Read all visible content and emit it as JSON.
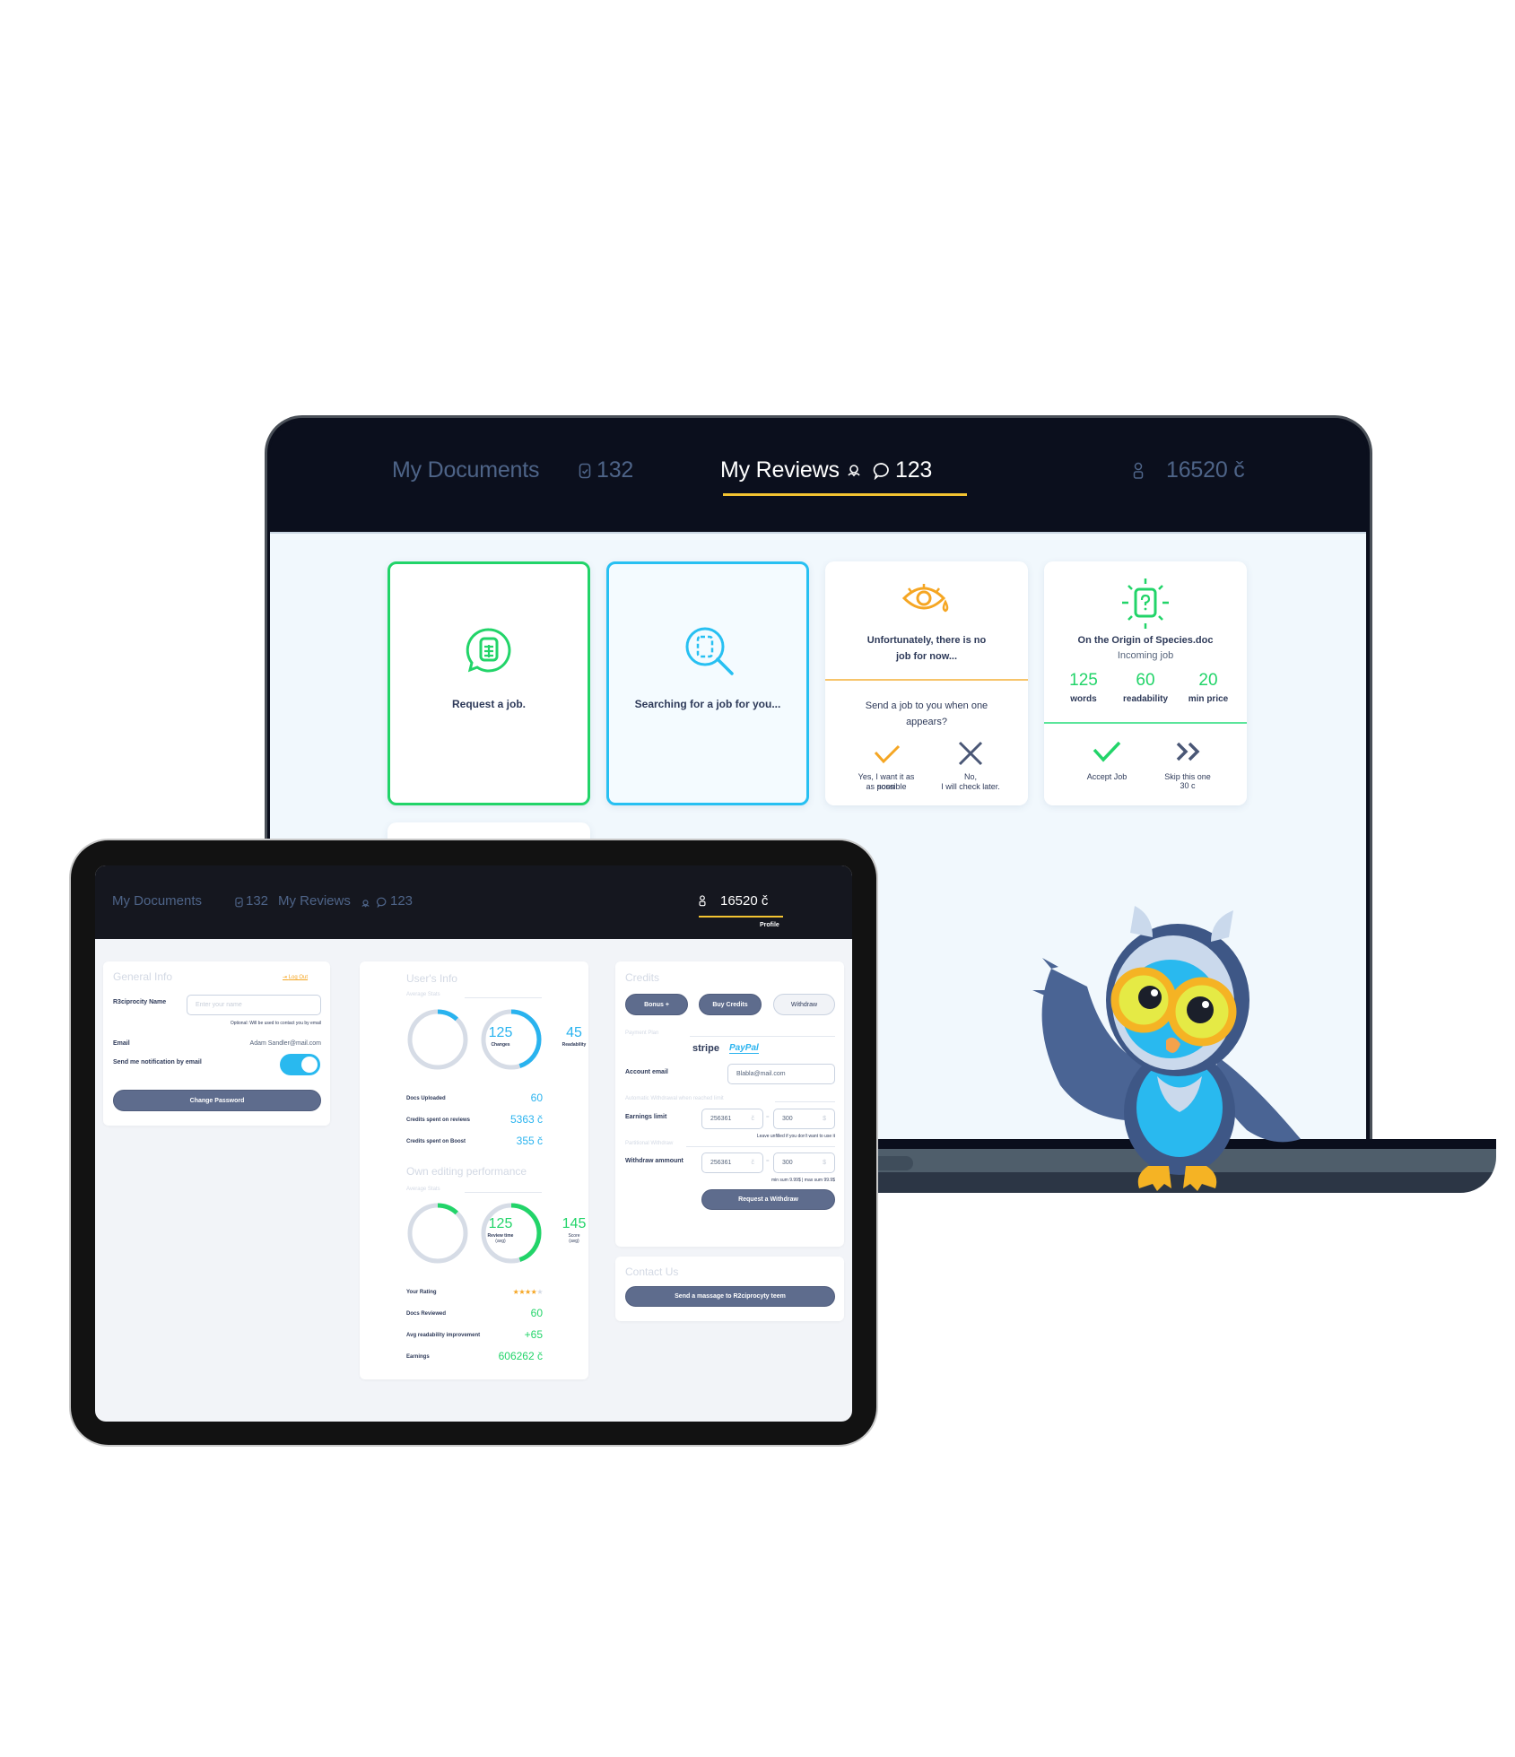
{
  "colors": {
    "accent_yellow": "#f3c331",
    "green": "#22d469",
    "blue": "#27c0f2",
    "orange": "#f5a623",
    "dark_nav": "#0b0f1d",
    "button_slate": "#5e6c8d"
  },
  "laptop": {
    "nav": {
      "documents_label": "My Documents",
      "documents_count": "132",
      "reviews_label": "My Reviews",
      "reviews_count": "123",
      "credits": "16520 č",
      "active_tab": "My Reviews"
    },
    "cards": {
      "request": {
        "label": "Request a job."
      },
      "searching": {
        "label": "Searching for a job for you..."
      },
      "no_job": {
        "title_line1": "Unfortunately, there is no",
        "title_line2": "job for now...",
        "question_line1": "Send a job to you when one",
        "question_line2": "appears?",
        "yes_line1": "Yes, I want it as soon",
        "yes_line2": "as possible",
        "no_line1": "No,",
        "no_line2": "I will check later."
      },
      "incoming": {
        "title": "On the Origin of Species.doc",
        "subtitle": "Incoming job",
        "stats": [
          {
            "value": "125",
            "label": "words"
          },
          {
            "value": "60",
            "label": "readability"
          },
          {
            "value": "20",
            "label": "min price"
          }
        ],
        "accept_label": "Accept Job",
        "skip_line1": "Skip this one",
        "skip_line2": "30 c"
      }
    }
  },
  "tablet": {
    "nav": {
      "documents_label": "My Documents",
      "documents_count": "132",
      "reviews_label": "My Reviews",
      "reviews_count": "123",
      "credits": "16520 č",
      "profile_label": "Profile",
      "active_tab": "Profile"
    },
    "general_info": {
      "title": "General Info",
      "logout_label": "Log Out",
      "name_label": "R3ciprocity Name",
      "name_placeholder": "Enter your name",
      "name_hint": "Optional: Will be used to contact you by email",
      "email_label": "Email",
      "email_value": "Adam Sandler@mail.com",
      "notify_label": "Send me notification by email",
      "notify_on": true,
      "change_password_label": "Change Password"
    },
    "users_info": {
      "title": "User's Info",
      "avg_stats_label": "Average Stats",
      "rings": [
        {
          "value": "125",
          "label": "Changes",
          "fraction": 0.12
        },
        {
          "value": "45",
          "label": "Readability",
          "fraction": 0.45
        }
      ],
      "rows": [
        {
          "label": "Docs Uploaded",
          "value": "60"
        },
        {
          "label": "Credits spent on reviews",
          "value": "5363 č"
        },
        {
          "label": "Credits spent on Boost",
          "value": "355 č"
        }
      ]
    },
    "performance": {
      "title": "Own editing performance",
      "avg_stats_label": "Average Stats",
      "rings": [
        {
          "value": "125",
          "label_line1": "Review time",
          "label_line2": "(avg)",
          "fraction": 0.12
        },
        {
          "value": "145",
          "label_line1": "Score",
          "label_line2": "(avg)",
          "fraction": 0.45
        }
      ],
      "rating_label": "Your Rating",
      "rating_stars": 4,
      "rating_max": 5,
      "rows": [
        {
          "label": "Docs Reviewed",
          "value": "60"
        },
        {
          "label": "Avg readability improvement",
          "value": "+65"
        },
        {
          "label": "Earnings",
          "value": "606262 č"
        }
      ]
    },
    "credits": {
      "title": "Credits",
      "bonus_label": "Bonus +",
      "buy_label": "Buy Credits",
      "withdraw_label": "Withdraw",
      "payment_plan_label": "Payment Plan",
      "stripe_label": "stripe",
      "paypal_label": "PayPal",
      "account_email_label": "Account email",
      "account_email_value": "Blabla@mail.com",
      "auto_withdraw_label": "Automatic Withdrawal when reached limit",
      "earnings_limit_label": "Earnings limit",
      "earnings_limit_credits": "256361",
      "earnings_limit_usd": "300",
      "earnings_hint": "Leave unfilled if you don't want to use it",
      "partial_withdraw_label": "Partitional Withdraw",
      "withdraw_amount_label": "Withdraw ammount",
      "withdraw_amount_credits": "256361",
      "withdraw_amount_usd": "300",
      "withdraw_hint": "min sum 9.99$ | max sum 99.9$",
      "request_withdraw_label": "Request a Withdraw",
      "credit_symbol": "č",
      "usd_symbol": "$",
      "equals_symbol": "="
    },
    "contact": {
      "title": "Contact Us",
      "send_label": "Send a massage to R2ciprocyty teem"
    }
  }
}
